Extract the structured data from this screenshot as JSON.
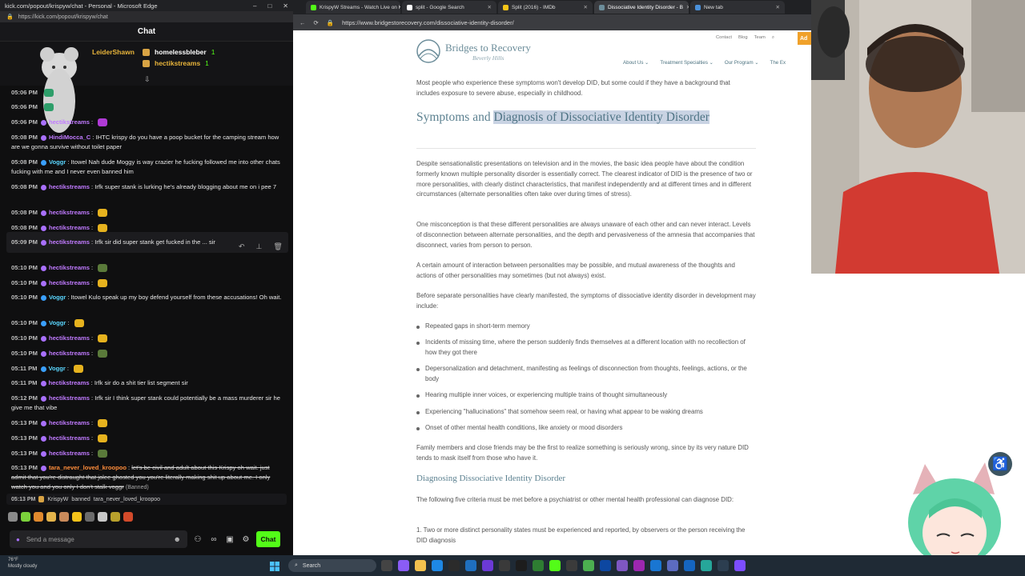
{
  "chat_window": {
    "title": "kick.com/popout/krispyw/chat - Personal - Microsoft Edge",
    "url": "https://kick.com/popout/krispyw/chat",
    "header": "Chat",
    "pinned": [
      {
        "name": "LeiderShawn",
        "count": ""
      },
      {
        "name": "homelessbleber",
        "count": "1"
      },
      {
        "name": "hectikstreams",
        "count": "1"
      }
    ],
    "messages": [
      {
        "time": "05:06 PM",
        "user": "",
        "text": ""
      },
      {
        "time": "05:06 PM",
        "user": "",
        "text": ""
      },
      {
        "time": "05:06 PM",
        "user": "hectikstreams",
        "text": ""
      },
      {
        "time": "05:08 PM",
        "user": "HindiMocca_C",
        "text": "IHTC krispy do you have a poop bucket for the camping stream how are we gonna survive without toilet paper"
      },
      {
        "time": "05:08 PM",
        "user": "Voggr",
        "text": "Itowel Nah dude Moggy is way crazier he fucking followed me into other chats fucking with me and I never even banned him"
      },
      {
        "time": "05:08 PM",
        "user": "hectikstreams",
        "text": "Irfk super stank is lurking he's already blogging about me on i pee 7"
      },
      {
        "time": "05:08 PM",
        "user": "hectikstreams",
        "text": ""
      },
      {
        "time": "05:08 PM",
        "user": "hectikstreams",
        "text": ""
      },
      {
        "time": "05:09 PM",
        "user": "hectikstreams",
        "text": "Irfk sir did super stank get fucked in the ... sir"
      },
      {
        "time": "05:10 PM",
        "user": "hectikstreams",
        "text": ""
      },
      {
        "time": "05:10 PM",
        "user": "hectikstreams",
        "text": ""
      },
      {
        "time": "05:10 PM",
        "user": "Voggr",
        "text": "Itowel Kulo speak up my boy defend yourself from these accusations! Oh wait."
      },
      {
        "time": "05:10 PM",
        "user": "Voggr",
        "text": ""
      },
      {
        "time": "05:10 PM",
        "user": "hectikstreams",
        "text": ""
      },
      {
        "time": "05:10 PM",
        "user": "hectikstreams",
        "text": ""
      },
      {
        "time": "05:11 PM",
        "user": "Voggr",
        "text": ""
      },
      {
        "time": "05:11 PM",
        "user": "hectikstreams",
        "text": "Irfk sir do a shit tier list segment sir"
      },
      {
        "time": "05:12 PM",
        "user": "hectikstreams",
        "text": "Irfk sir I think super stank could potentially be a mass murderer sir he give me that vibe"
      },
      {
        "time": "05:13 PM",
        "user": "hectikstreams",
        "text": ""
      },
      {
        "time": "05:13 PM",
        "user": "hectikstreams",
        "text": ""
      },
      {
        "time": "05:13 PM",
        "user": "hectikstreams",
        "text": ""
      },
      {
        "time": "05:13 PM",
        "user": "tara_never_loved_kroopoo",
        "text": "let's be civil and adult about this Krispy oh wait. just admit that you're distraught that jolee ghosted you you're literally making shit up about me. I only watch you and you only I don't stalk voggr",
        "banned": "(Banned)"
      }
    ],
    "ban_notice": {
      "time": "05:13 PM",
      "moderator": "KrispyW",
      "action": "banned",
      "target": "tara_never_loved_kroopoo"
    },
    "input_placeholder": "Send a message",
    "chat_button": "Chat"
  },
  "browser": {
    "tabs": [
      {
        "label": "KrispyW Streams - Watch Live on K",
        "color": "#53fc18"
      },
      {
        "label": "split - Google Search",
        "color": "#ffffff"
      },
      {
        "label": "Split (2016) - IMDb",
        "color": "#f5c518"
      },
      {
        "label": "Dissociative Identity Disorder - B",
        "color": "#6c8d9a"
      },
      {
        "label": "New tab",
        "color": "#4a90d9"
      }
    ],
    "url": "https://www.bridgestorecovery.com/dissociative-identity-disorder/",
    "site": {
      "logo_name": "Bridges to Recovery",
      "logo_sub": "Beverly Hills",
      "top_links": [
        "Contact",
        "Blog",
        "Team"
      ],
      "admit": "Ad",
      "nav": [
        "About Us",
        "Treatment Specialties",
        "Our Program",
        "The Ex"
      ]
    },
    "article": {
      "intro": "Most people who experience these symptoms won't develop DID, but some could if they have a background that includes exposure to severe abuse, especially in childhood.",
      "heading_plain": "Symptoms and",
      "heading_highlighted": "Diagnosis of Dissociative Identity Disorder",
      "p1": "Despite sensationalistic presentations on television and in the movies, the basic idea people have about the condition formerly known multiple personality disorder is essentially correct. The clearest indicator of DID is the presence of two or more personalities, with clearly distinct characteristics, that manifest independently and at different times and in different circumstances (alternate personalities often take over during times of stress).",
      "p2": "One misconception is that these different personalities are always unaware of each other and can never interact. Levels of disconnection between alternate personalities, and the depth and pervasiveness of the amnesia that accompanies that disconnect, varies from person to person.",
      "p3": "A certain amount of interaction between personalities may be possible, and mutual awareness of the thoughts and actions of other personalities may sometimes (but not always) exist.",
      "p4": "Before separate personalities have clearly manifested, the symptoms of dissociative identity disorder in development may include:",
      "bullets": [
        "Repeated gaps in short-term memory",
        "Incidents of missing time, where the person suddenly finds themselves at a different location with no recollection of how they got there",
        "Depersonalization and detachment, manifesting as feelings of disconnection from thoughts, feelings, actions, or the body",
        "Hearing multiple inner voices, or experiencing multiple trains of thought simultaneously",
        "Experiencing \"hallucinations\" that somehow seem real, or having what appear to be waking dreams",
        "Onset of other mental health conditions, like anxiety or mood disorders"
      ],
      "p5": "Family members and close friends may be the first to realize something is seriously wrong, since by its very nature DID tends to mask itself from those who have it.",
      "h3": "Diagnosing Dissociative Identity Disorder",
      "p6": "The following five criteria must be met before a psychiatrist or other mental health professional can diagnose DID:",
      "ol1": "1.  Two or more distinct personality states must be experienced and reported, by observers or the person receiving the DID diagnosis"
    }
  },
  "taskbar": {
    "weather_temp": "76°F",
    "weather_desc": "Mostly cloudy",
    "search": "Search"
  }
}
